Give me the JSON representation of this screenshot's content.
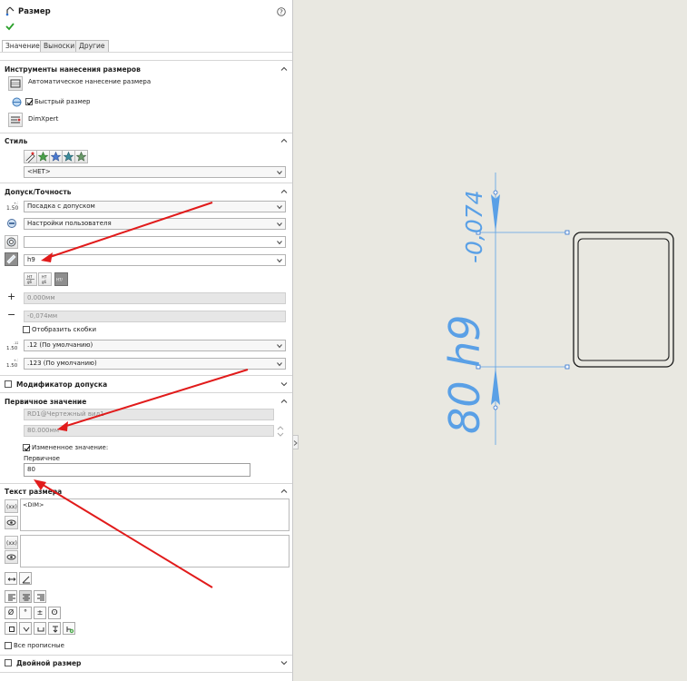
{
  "panel": {
    "title": "Размер",
    "help_icon": "question-icon",
    "ok_icon": "checkmark-icon",
    "tabs": [
      "Значение",
      "Выноски",
      "Другие"
    ]
  },
  "tools": {
    "header": "Инструменты нанесения размеров",
    "auto_dim": "Автоматическое нанесение размера",
    "quick_dim": "Быстрый размер",
    "dimxpert": "DimXpert"
  },
  "style": {
    "header": "Стиль",
    "value": "<НЕТ>"
  },
  "tolerance": {
    "header": "Допуск/Точность",
    "type": "Посадка с допуском",
    "classification": "Настройки пользователя",
    "hole_fit": "",
    "shaft_fit": "h9",
    "upper": "0.000мм",
    "lower": "-0,074мм",
    "show_parens": "Отобразить скобки",
    "primary_precision": ".12 (По умолчанию)",
    "tol_precision": ".123 (По умолчанию)"
  },
  "tol_modifier": {
    "header": "Модификатор допуска"
  },
  "primary_value": {
    "header": "Первичное значение",
    "reference": "RD1@Чертежный вид1",
    "value": "80.000мм",
    "override_label": "Измененное значение:",
    "primary_label": "Первичное",
    "primary_value": "80"
  },
  "dim_text": {
    "header": "Текст размера",
    "text": "<DIM>",
    "all_caps": "Все прописные",
    "symbols": [
      "Ø",
      "°",
      "±",
      "ⵙ"
    ]
  },
  "dual": {
    "header": "Двойной размер"
  },
  "drawing": {
    "dim_value": "80 h9",
    "tolerance": "-0,074"
  },
  "colors": {
    "annotation": "#5aa0e6",
    "arrow": "#e11b1b",
    "canvas": "#e9e8e1"
  }
}
